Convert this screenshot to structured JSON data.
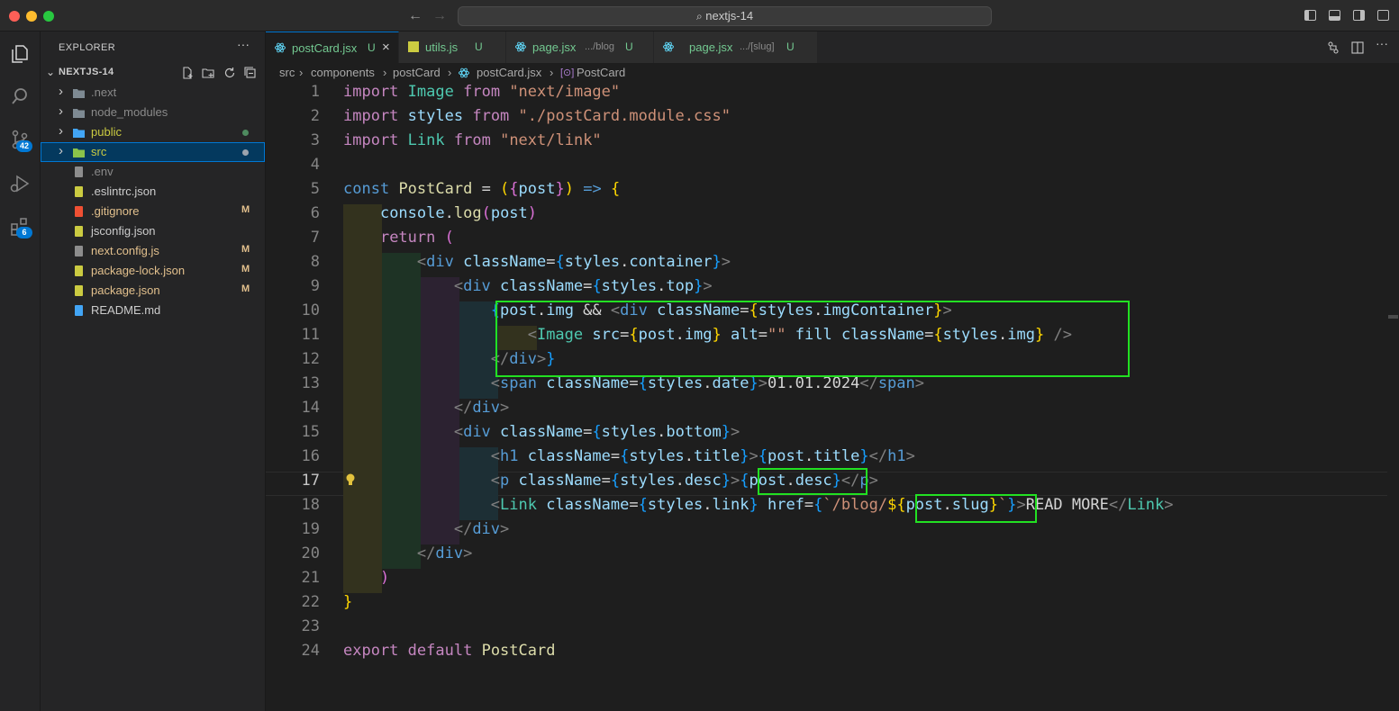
{
  "window": {
    "title": "nextjs-14"
  },
  "explorer": {
    "title": "EXPLORER",
    "more": "···",
    "project": "NEXTJS-14",
    "items": [
      {
        "name": ".next",
        "type": "folder",
        "color": "#8a8a8a"
      },
      {
        "name": "node_modules",
        "type": "folder",
        "color": "#8a8a8a"
      },
      {
        "name": "public",
        "type": "folder",
        "color": "#cbcb41",
        "dot": "#4e8b5f"
      },
      {
        "name": "src",
        "type": "folder",
        "color": "#cbcb41",
        "dot": "#9ca3ad",
        "selected": true
      },
      {
        "name": ".env",
        "type": "file",
        "color": "#8a8a8a"
      },
      {
        "name": ".eslintrc.json",
        "type": "file",
        "color": "#cccccc"
      },
      {
        "name": ".gitignore",
        "type": "file",
        "color": "#e2c08d",
        "status": "M"
      },
      {
        "name": "jsconfig.json",
        "type": "file",
        "color": "#cccccc"
      },
      {
        "name": "next.config.js",
        "type": "file",
        "color": "#e2c08d",
        "status": "M"
      },
      {
        "name": "package-lock.json",
        "type": "file",
        "color": "#e2c08d",
        "status": "M"
      },
      {
        "name": "package.json",
        "type": "file",
        "color": "#e2c08d",
        "status": "M"
      },
      {
        "name": "README.md",
        "type": "file",
        "color": "#cccccc"
      }
    ]
  },
  "activity": {
    "scm_badge": "42",
    "extensions_badge": "6"
  },
  "tabs": [
    {
      "name": "postCard.jsx",
      "status": "U",
      "close": "×",
      "active": true
    },
    {
      "name": "utils.js",
      "status": "U"
    },
    {
      "name": "page.jsx",
      "desc": ".../blog",
      "status": "U"
    },
    {
      "name": "page.jsx",
      "desc": ".../[slug]",
      "status": "U"
    }
  ],
  "breadcrumb": {
    "sep": "›",
    "parts": [
      "src",
      "components",
      "postCard",
      "postCard.jsx",
      "PostCard"
    ]
  },
  "editor": {
    "current_line": 17,
    "line_numbers": [
      "1",
      "2",
      "3",
      "4",
      "5",
      "6",
      "7",
      "8",
      "9",
      "10",
      "11",
      "12",
      "13",
      "14",
      "15",
      "16",
      "17",
      "18",
      "19",
      "20",
      "21",
      "22",
      "23",
      "24"
    ]
  },
  "colors": {
    "accent": "#0078d4",
    "highlight_box": "#22e022",
    "modified": "#e2c08d",
    "untracked": "#73c991"
  }
}
